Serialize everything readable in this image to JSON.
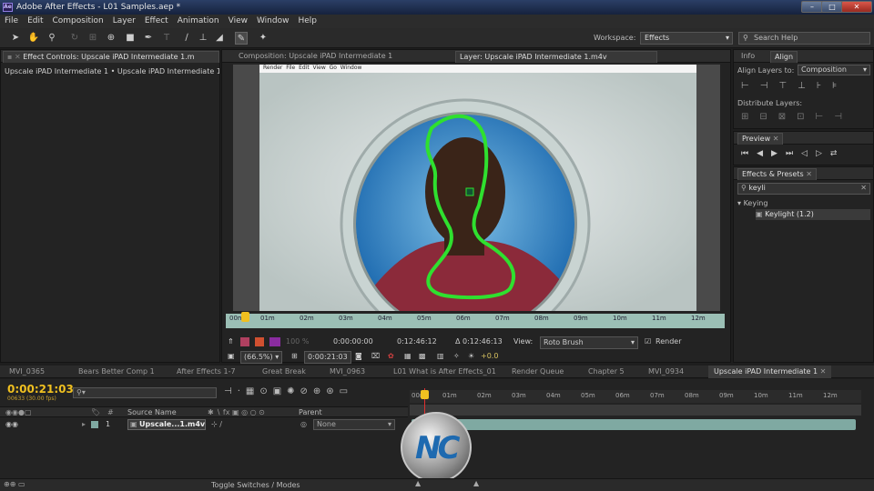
{
  "window": {
    "title": "Adobe After Effects - L01 Samples.aep *",
    "app_icon": "Ae"
  },
  "menu": [
    "File",
    "Edit",
    "Composition",
    "Layer",
    "Effect",
    "Animation",
    "View",
    "Window",
    "Help"
  ],
  "toolbar": {
    "workspace_label": "Workspace:",
    "workspace_value": "Effects",
    "search_placeholder": "Search Help"
  },
  "left_panel": {
    "tab": "Effect Controls: Upscale iPAD Intermediate 1.m",
    "layer_path": "Upscale iPAD Intermediate 1 • Upscale iPAD Intermediate 1.m"
  },
  "viewer": {
    "tab_composition": "Composition: Upscale iPAD Intermediate 1",
    "tab_layer": "Layer: Upscale iPAD Intermediate 1.m4v",
    "inner_menu": [
      "Render",
      "File",
      "Edit",
      "View",
      "Go",
      "Window"
    ],
    "ruler_ticks": [
      "00m",
      "01m",
      "02m",
      "03m",
      "04m",
      "05m",
      "06m",
      "07m",
      "08m",
      "09m",
      "10m",
      "11m",
      "12m"
    ],
    "timecode_start": "0:00:00:00",
    "timecode_end": "0:12:46:12",
    "timecode_duration": "Δ 0:12:46:13",
    "zoom": "(66.5%)",
    "current_time": "0:00:21:03",
    "view_label": "View:",
    "view_value": "Roto Brush",
    "render_label": "Render",
    "render_checked": true,
    "exposure": "+0.0",
    "resolution": "100 %"
  },
  "right": {
    "info_tab": "Info",
    "align_tab": "Align",
    "align_layers_to": "Align Layers to:",
    "align_target": "Composition",
    "distribute_layers": "Distribute Layers:",
    "preview_tab": "Preview",
    "effects_tab": "Effects & Presets",
    "effects_search": "keyli",
    "category": "Keying",
    "effect_item": "Keylight (1.2)"
  },
  "timeline": {
    "tabs": [
      "MVI_0365",
      "Bears Better Comp 1",
      "After Effects 1-7",
      "Great Break",
      "MVI_0963",
      "L01 What is After Effects_01",
      "Render Queue",
      "Chapter 5",
      "MVI_0934",
      "Upscale iPAD Intermediate 1"
    ],
    "current_time": "0:00:21:03",
    "frame_info": "00633 (30.00 fps)",
    "col_source": "Source Name",
    "col_parent": "Parent",
    "layer_num": "1",
    "layer_name": "Upscale...1.m4v",
    "parent_value": "None",
    "ticks": [
      "00m",
      "01m",
      "02m",
      "03m",
      "04m",
      "05m",
      "06m",
      "07m",
      "08m",
      "09m",
      "10m",
      "11m",
      "12m"
    ],
    "toggle_label": "Toggle Switches / Modes"
  },
  "watermark": "NC",
  "colors": {
    "accent": "#f0c020",
    "roto": "#2fe02f",
    "ruler": "#9bbfb5",
    "layer_bar": "#7fa9a2"
  }
}
